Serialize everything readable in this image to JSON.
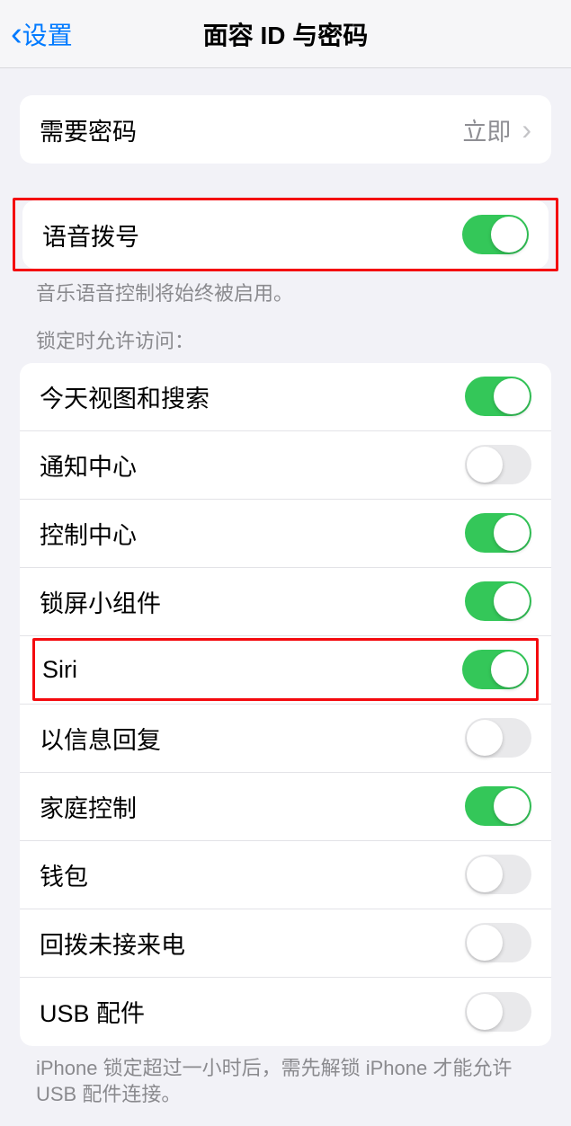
{
  "header": {
    "back_label": "设置",
    "title": "面容 ID 与密码"
  },
  "passcode_group": {
    "require_passcode_label": "需要密码",
    "require_passcode_value": "立即"
  },
  "voice_dial": {
    "label": "语音拨号",
    "footer": "音乐语音控制将始终被启用。",
    "enabled": true
  },
  "lock_access": {
    "header": "锁定时允许访问：",
    "items": [
      {
        "label": "今天视图和搜索",
        "enabled": true
      },
      {
        "label": "通知中心",
        "enabled": false
      },
      {
        "label": "控制中心",
        "enabled": true
      },
      {
        "label": "锁屏小组件",
        "enabled": true
      },
      {
        "label": "Siri",
        "enabled": true,
        "highlighted": true
      },
      {
        "label": "以信息回复",
        "enabled": false
      },
      {
        "label": "家庭控制",
        "enabled": true
      },
      {
        "label": "钱包",
        "enabled": false
      },
      {
        "label": "回拨未接来电",
        "enabled": false
      },
      {
        "label": "USB 配件",
        "enabled": false
      }
    ],
    "footer": "iPhone 锁定超过一小时后，需先解锁 iPhone 才能允许USB 配件连接。"
  }
}
